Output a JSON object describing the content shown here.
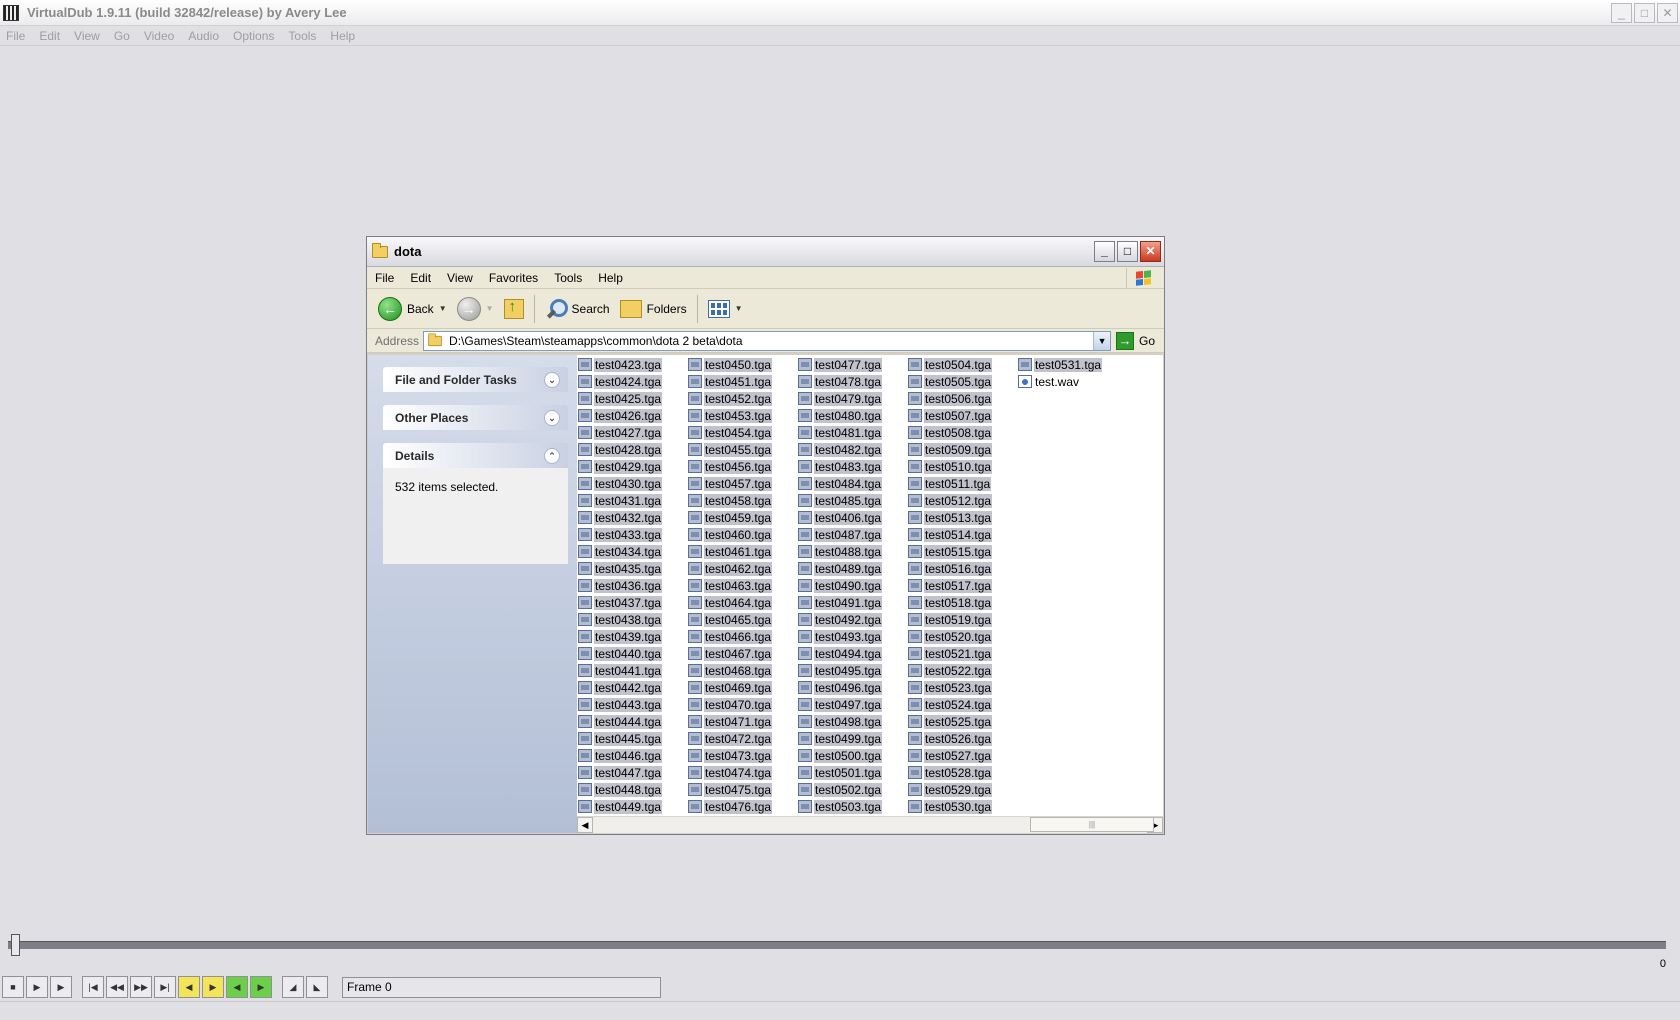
{
  "app": {
    "title": "VirtualDub 1.9.11 (build 32842/release) by Avery Lee",
    "menu": [
      "File",
      "Edit",
      "View",
      "Go",
      "Video",
      "Audio",
      "Options",
      "Tools",
      "Help"
    ],
    "window_buttons": [
      "_",
      "□",
      "✕"
    ]
  },
  "explorer": {
    "title": "dota",
    "window_buttons": [
      "_",
      "□",
      "✕"
    ],
    "menu": [
      "File",
      "Edit",
      "View",
      "Favorites",
      "Tools",
      "Help"
    ],
    "toolbar": {
      "back": "Back",
      "search": "Search",
      "folders": "Folders"
    },
    "address": {
      "label": "Address",
      "value": "D:\\Games\\Steam\\steamapps\\common\\dota 2 beta\\dota",
      "go": "Go"
    },
    "tasks": {
      "file_folder_tasks": "File and Folder Tasks",
      "other_places": "Other Places",
      "details": "Details",
      "details_text": "532 items selected."
    },
    "file_columns": [
      [
        "test0423.tga",
        "test0424.tga",
        "test0425.tga",
        "test0426.tga",
        "test0427.tga",
        "test0428.tga",
        "test0429.tga",
        "test0430.tga",
        "test0431.tga",
        "test0432.tga",
        "test0433.tga",
        "test0434.tga",
        "test0435.tga",
        "test0436.tga",
        "test0437.tga",
        "test0438.tga",
        "test0439.tga",
        "test0440.tga",
        "test0441.tga",
        "test0442.tga",
        "test0443.tga",
        "test0444.tga",
        "test0445.tga",
        "test0446.tga",
        "test0447.tga",
        "test0448.tga",
        "test0449.tga"
      ],
      [
        "test0450.tga",
        "test0451.tga",
        "test0452.tga",
        "test0453.tga",
        "test0454.tga",
        "test0455.tga",
        "test0456.tga",
        "test0457.tga",
        "test0458.tga",
        "test0459.tga",
        "test0460.tga",
        "test0461.tga",
        "test0462.tga",
        "test0463.tga",
        "test0464.tga",
        "test0465.tga",
        "test0466.tga",
        "test0467.tga",
        "test0468.tga",
        "test0469.tga",
        "test0470.tga",
        "test0471.tga",
        "test0472.tga",
        "test0473.tga",
        "test0474.tga",
        "test0475.tga",
        "test0476.tga"
      ],
      [
        "test0477.tga",
        "test0478.tga",
        "test0479.tga",
        "test0480.tga",
        "test0481.tga",
        "test0482.tga",
        "test0483.tga",
        "test0484.tga",
        "test0485.tga",
        "test0406.tga",
        "test0487.tga",
        "test0488.tga",
        "test0489.tga",
        "test0490.tga",
        "test0491.tga",
        "test0492.tga",
        "test0493.tga",
        "test0494.tga",
        "test0495.tga",
        "test0496.tga",
        "test0497.tga",
        "test0498.tga",
        "test0499.tga",
        "test0500.tga",
        "test0501.tga",
        "test0502.tga",
        "test0503.tga"
      ],
      [
        "test0504.tga",
        "test0505.tga",
        "test0506.tga",
        "test0507.tga",
        "test0508.tga",
        "test0509.tga",
        "test0510.tga",
        "test0511.tga",
        "test0512.tga",
        "test0513.tga",
        "test0514.tga",
        "test0515.tga",
        "test0516.tga",
        "test0517.tga",
        "test0518.tga",
        "test0519.tga",
        "test0520.tga",
        "test0521.tga",
        "test0522.tga",
        "test0523.tga",
        "test0524.tga",
        "test0525.tga",
        "test0526.tga",
        "test0527.tga",
        "test0528.tga",
        "test0529.tga",
        "test0530.tga"
      ],
      [
        "test0531.tga",
        "test.wav"
      ]
    ]
  },
  "timeline": {
    "end_label": "0"
  },
  "frame": {
    "label": "Frame 0"
  }
}
